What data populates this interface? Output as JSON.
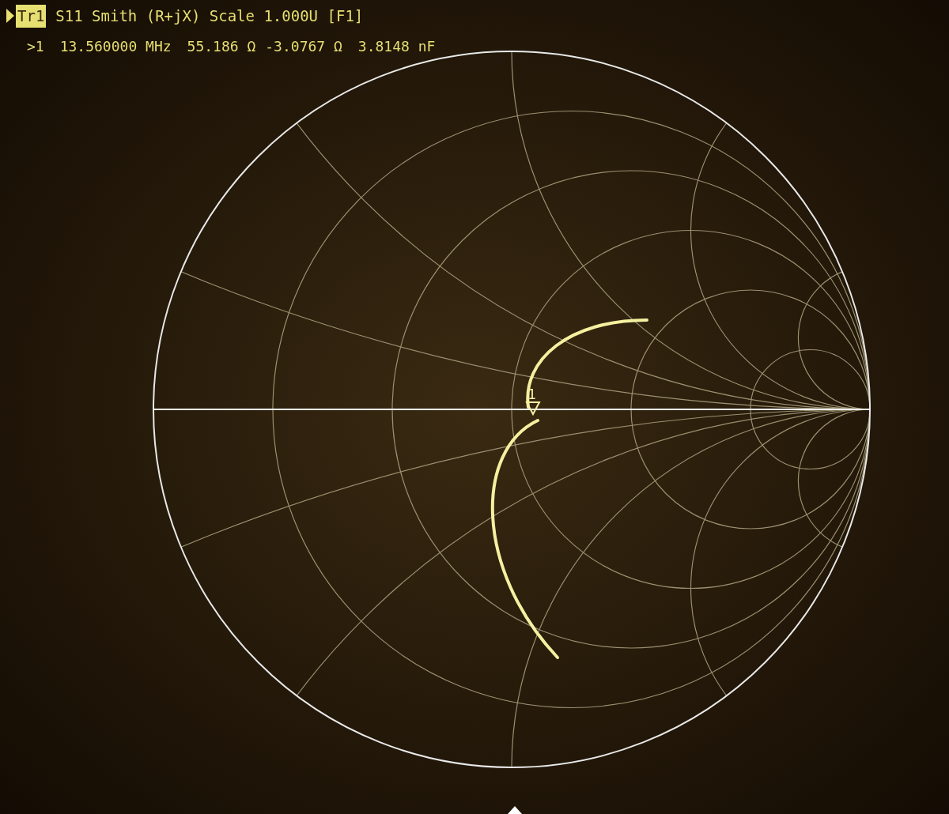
{
  "trace": {
    "label": "Tr1",
    "selected": true,
    "title": "S11 Smith (R+jX) Scale 1.000U [F1]"
  },
  "marker_readout": {
    "marker": ">1",
    "frequency": "13.560000 MHz",
    "resistance": "55.186 Ω",
    "reactance": "-3.0767 Ω",
    "value": "3.8148 nF"
  },
  "chart": {
    "marker_label": "1"
  }
}
